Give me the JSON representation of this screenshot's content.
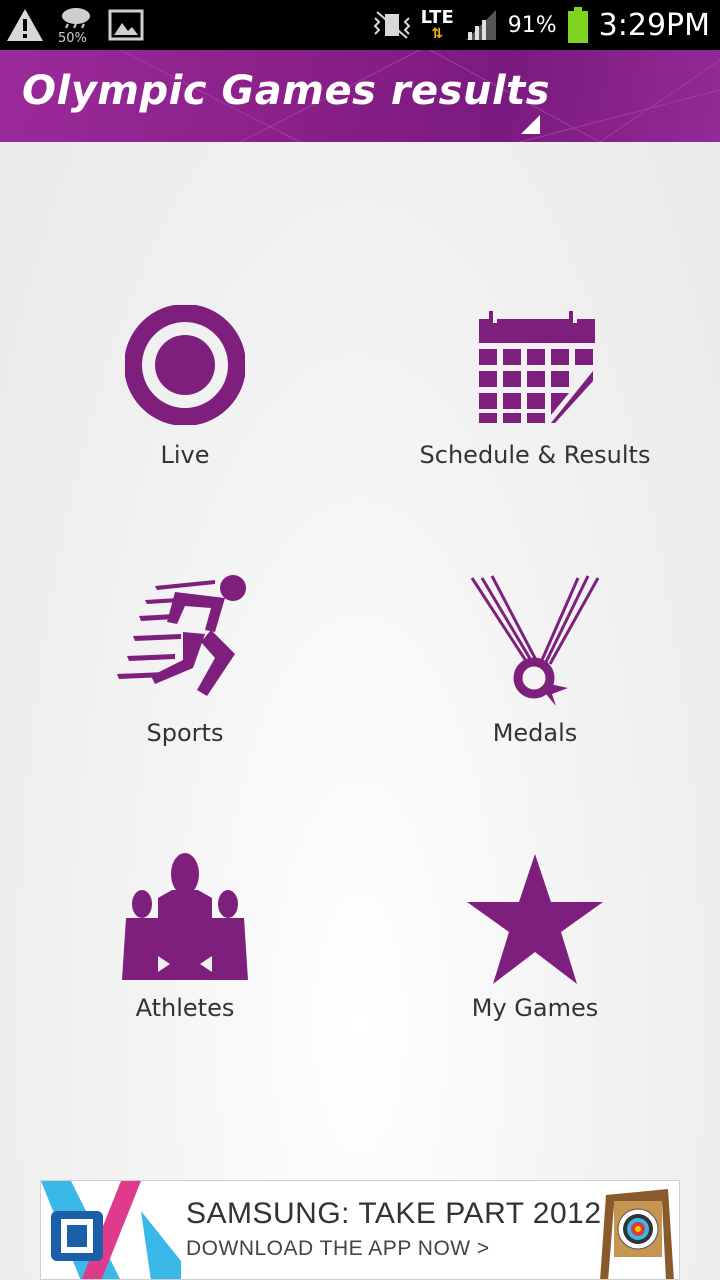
{
  "status_bar": {
    "weather_percent": "50%",
    "network": "LTE",
    "battery": "91%",
    "time": "3:29PM"
  },
  "header": {
    "title": "Olympic Games results"
  },
  "menu": {
    "items": [
      {
        "label": "Live",
        "icon": "live-ring-icon"
      },
      {
        "label": "Schedule & Results",
        "icon": "calendar-icon"
      },
      {
        "label": "Sports",
        "icon": "runner-icon"
      },
      {
        "label": "Medals",
        "icon": "medal-icon"
      },
      {
        "label": "Athletes",
        "icon": "athletes-icon"
      },
      {
        "label": "My Games",
        "icon": "star-icon"
      }
    ]
  },
  "ad": {
    "headline": "SAMSUNG: TAKE PART 2012",
    "cta": "DOWNLOAD THE APP NOW >"
  },
  "colors": {
    "brand_purple": "#7e1f7e",
    "header_purple": "#8a2088",
    "status_bar": "#000000",
    "battery_green": "#7ed321"
  }
}
